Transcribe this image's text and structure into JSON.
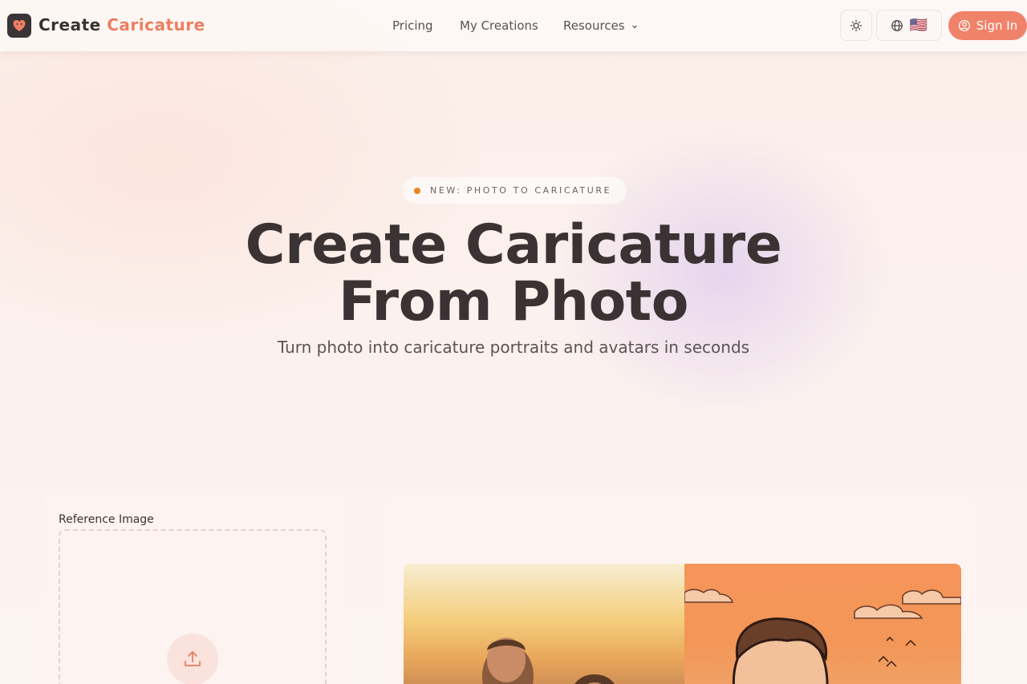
{
  "header": {
    "logo_word1": "Create",
    "logo_word2": "Caricature",
    "nav": [
      "Pricing",
      "My Creations",
      "Resources"
    ],
    "theme_icon": "sun-icon",
    "language_icon": "globe-icon",
    "language_flag": "🇺🇸",
    "signin_label": "Sign In"
  },
  "hero": {
    "badge": "NEW: PHOTO TO CARICATURE",
    "title_line1": "Create Caricature",
    "title_line2": "From Photo",
    "subtitle": "Turn photo into caricature portraits and avatars in seconds"
  },
  "upload": {
    "label": "Reference Image",
    "icon": "upload-icon"
  },
  "colors": {
    "accent": "#f0826a",
    "brand_text": "#ee7e62",
    "dark": "#3b3333",
    "badge_dot": "#ec8423"
  }
}
